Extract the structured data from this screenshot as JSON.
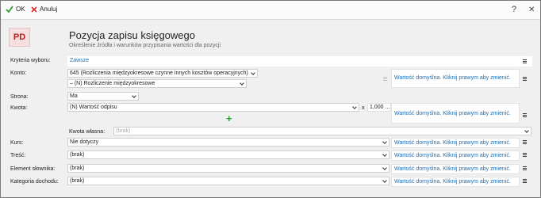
{
  "toolbar": {
    "ok_label": "OK",
    "cancel_label": "Anuluj",
    "help_label": "?",
    "close_label": "✕"
  },
  "header": {
    "badge": "PD",
    "title": "Pozycja zapisu księgowego",
    "subtitle": "Określenie źródła i warunków przypisania wartości dla pozycji"
  },
  "form": {
    "criteria": {
      "label": "Kryteria wyboru:",
      "value": "Zawsze"
    },
    "account": {
      "label": "Konto:",
      "value": "645 (Rozliczenia międzyokresowe czynne innych kosztów operacyjnych)",
      "sub_value": "– (N) Rozliczenie międzyokresowe"
    },
    "side": {
      "label": "Strona:",
      "value": "Ma"
    },
    "amount": {
      "label": "Kwota:",
      "value": "(N) Wartość odpisu",
      "multiplier_sign": "x",
      "multiplier": "1,000 ..."
    },
    "own_amount": {
      "label": "Kwota własna:",
      "placeholder": "(brak)"
    },
    "rate": {
      "label": "Kurs:",
      "value": "Nie dotyczy"
    },
    "content": {
      "label": "Treść:",
      "value": "(brak)"
    },
    "dictionary": {
      "label": "Element słownika:",
      "value": "(brak)"
    },
    "income_category": {
      "label": "Kategoria dochodu:",
      "value": "(brak)"
    }
  },
  "default_value_text": "Wartość domyślna. Kliknij prawym aby zmienić.",
  "colors": {
    "accent": "#1a6fb8",
    "badge": "#b22222",
    "plus": "#2e9d2e"
  }
}
